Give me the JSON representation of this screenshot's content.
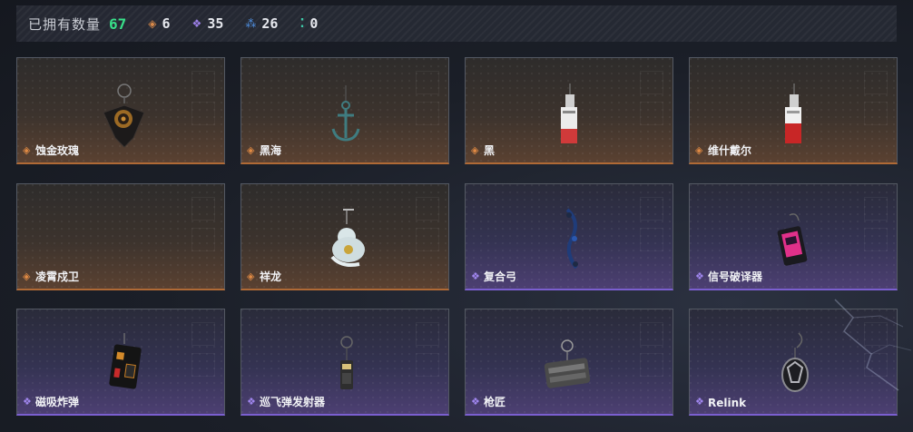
{
  "header": {
    "owned_label": "已拥有数量",
    "owned_count": "67",
    "stats": [
      {
        "icon": "orange-diamond-icon",
        "value": "6"
      },
      {
        "icon": "purple-diamond-icon",
        "value": "35"
      },
      {
        "icon": "blue-triangle-icon",
        "value": "26"
      },
      {
        "icon": "teal-dots-icon",
        "value": "0"
      }
    ]
  },
  "colors": {
    "gold": "#b06a36",
    "purple": "#7b5fd0",
    "count_green": "#38e08a"
  },
  "cards": [
    {
      "name": "蚀金玫瑰",
      "rarity": "gold",
      "icon": "rose-charm-icon"
    },
    {
      "name": "黑海",
      "rarity": "gold",
      "icon": "anchor-charm-icon"
    },
    {
      "name": "黑",
      "rarity": "gold",
      "icon": "tag-charm-icon"
    },
    {
      "name": "维什戴尔",
      "rarity": "gold",
      "icon": "tag-charm-red-icon"
    },
    {
      "name": "凌霄戍卫",
      "rarity": "gold",
      "icon": "empty-charm-icon"
    },
    {
      "name": "祥龙",
      "rarity": "gold",
      "icon": "dragon-charm-icon"
    },
    {
      "name": "复合弓",
      "rarity": "purple",
      "icon": "bow-charm-icon"
    },
    {
      "name": "信号破译器",
      "rarity": "purple",
      "icon": "decoder-charm-icon"
    },
    {
      "name": "磁吸炸弹",
      "rarity": "purple",
      "icon": "bomb-charm-icon"
    },
    {
      "name": "巡飞弹发射器",
      "rarity": "purple",
      "icon": "launcher-charm-icon"
    },
    {
      "name": "枪匠",
      "rarity": "purple",
      "icon": "gunsmith-box-charm-icon"
    },
    {
      "name": "Relink",
      "rarity": "purple",
      "icon": "relink-charm-icon"
    }
  ]
}
